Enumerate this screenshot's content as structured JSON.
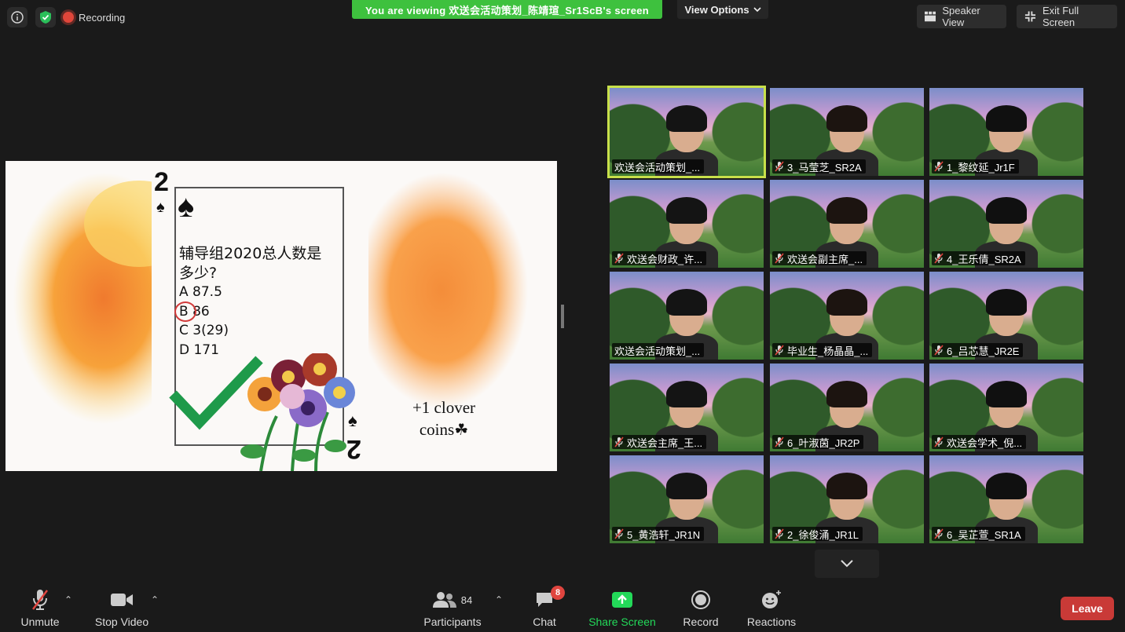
{
  "top": {
    "recording": "Recording",
    "banner": "You are viewing 欢送会活动策划_陈靖瑄_Sr1ScB's screen",
    "view_options": "View Options",
    "speaker_view": "Speaker View",
    "exit_full_screen": "Exit Full Screen"
  },
  "slide": {
    "card_rank": "2",
    "question_line1": "辅导组2020总人数是",
    "question_line2": "多少?",
    "option_a": "A 87.5",
    "option_b": "B 86",
    "option_c": "C 3(29)",
    "option_d": "D 171",
    "bonus_line1": "+1 clover",
    "bonus_line2": "coins"
  },
  "participants": [
    {
      "name": "欢送会活动策划_...",
      "muted": false
    },
    {
      "name": "3_马莹芝_SR2A",
      "muted": true
    },
    {
      "name": "1_黎纹延_Jr1F",
      "muted": true
    },
    {
      "name": "欢送会财政_许...",
      "muted": true
    },
    {
      "name": "欢送会副主席_...",
      "muted": true
    },
    {
      "name": "4_王乐倩_SR2A",
      "muted": true
    },
    {
      "name": "欢送会活动策划_...",
      "muted": false
    },
    {
      "name": "毕业生_杨晶晶_...",
      "muted": true
    },
    {
      "name": "6_吕芯慧_JR2E",
      "muted": true
    },
    {
      "name": "欢送会主席_王...",
      "muted": true
    },
    {
      "name": "6_叶淑茵_JR2P",
      "muted": true
    },
    {
      "name": "欢送会学术_倪...",
      "muted": true
    },
    {
      "name": "5_黄浩轩_JR1N",
      "muted": true
    },
    {
      "name": "2_徐俊涌_JR1L",
      "muted": true
    },
    {
      "name": "6_吴芷萱_SR1A",
      "muted": true
    }
  ],
  "toolbar": {
    "unmute": "Unmute",
    "stop_video": "Stop Video",
    "participants": "Participants",
    "participants_count": "84",
    "chat": "Chat",
    "chat_badge": "8",
    "share_screen": "Share Screen",
    "record": "Record",
    "reactions": "Reactions",
    "leave": "Leave"
  },
  "colors": {
    "banner": "#3ec13e",
    "active_speaker": "#c8e04a",
    "share_screen": "#23d959",
    "leave": "#c93a37",
    "badge": "#e0453f"
  }
}
